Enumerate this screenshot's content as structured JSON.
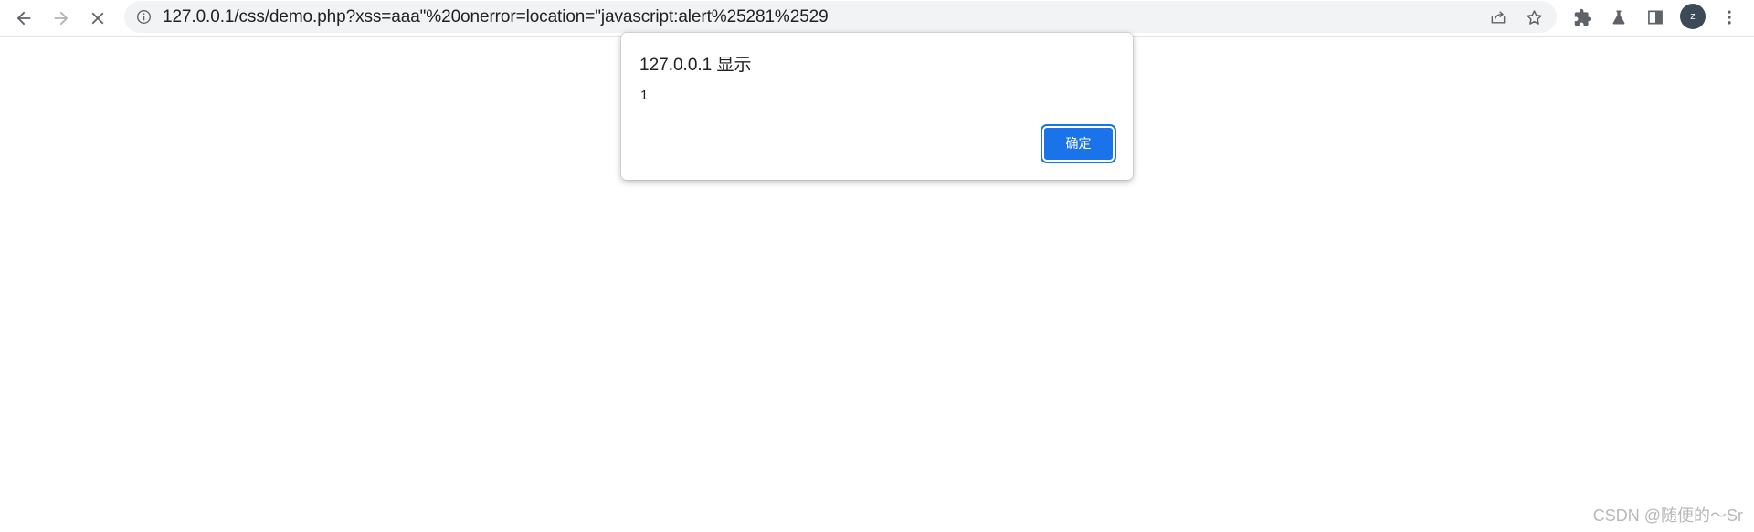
{
  "browser": {
    "url": "127.0.0.1/css/demo.php?xss=aaa\"%20onerror=location=\"javascript:alert%25281%2529",
    "avatar_letter": "z",
    "icons": {
      "back": "arrow-left-icon",
      "forward": "arrow-right-icon",
      "stop": "close-icon",
      "site_info": "info-icon",
      "share": "share-icon",
      "bookmark": "star-icon",
      "extensions": "puzzle-icon",
      "labs": "flask-icon",
      "side_panel": "side-panel-icon",
      "menu": "kebab-menu-icon"
    },
    "colors": {
      "accent": "#1a73e8",
      "omnibox_bg": "#f1f3f4",
      "avatar_bg": "#3c4a57"
    }
  },
  "dialog": {
    "title": "127.0.0.1 显示",
    "message": "1",
    "ok_label": "确定"
  },
  "watermark": "CSDN @随便的～Sr"
}
